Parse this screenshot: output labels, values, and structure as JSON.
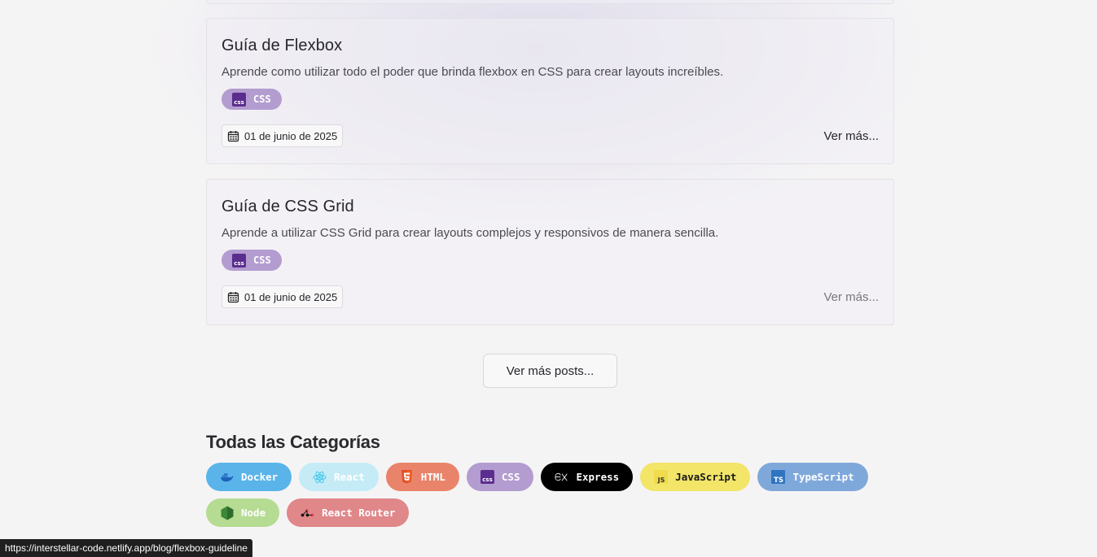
{
  "posts": [
    {
      "title": "Guía de Flexbox",
      "description": "Aprende como utilizar todo el poder que brinda flexbox en CSS para crear layouts increíbles.",
      "tag": "CSS",
      "date": "01 de junio de 2025",
      "see_more": "Ver más..."
    },
    {
      "title": "Guía de CSS Grid",
      "description": "Aprende a utilizar CSS Grid para crear layouts complejos y responsivos de manera sencilla.",
      "tag": "CSS",
      "date": "01 de junio de 2025",
      "see_more": "Ver más..."
    }
  ],
  "more_posts_label": "Ver más posts...",
  "categories": {
    "title": "Todas las Categorías",
    "items": [
      {
        "label": "Docker",
        "icon": "docker-icon",
        "color": "#5ab4ea",
        "text_color": "#ffffff"
      },
      {
        "label": "React",
        "icon": "react-icon",
        "color": "#c5ecf6",
        "text_color": "#ffffff"
      },
      {
        "label": "HTML",
        "icon": "html5-icon",
        "color": "#e9846a",
        "text_color": "#ffffff"
      },
      {
        "label": "CSS",
        "icon": "css-icon",
        "color": "#b39cd0",
        "text_color": "#ffffff"
      },
      {
        "label": "Express",
        "icon": "express-icon",
        "color": "#000000",
        "text_color": "#ffffff"
      },
      {
        "label": "JavaScript",
        "icon": "javascript-icon",
        "color": "#f2e568",
        "text_color": "#1a1a1a"
      },
      {
        "label": "TypeScript",
        "icon": "typescript-icon",
        "color": "#7fa8da",
        "text_color": "#ffffff"
      },
      {
        "label": "Node",
        "icon": "node-icon",
        "color": "#b5dc92",
        "text_color": "#ffffff"
      },
      {
        "label": "React Router",
        "icon": "react-router-icon",
        "color": "#e0878a",
        "text_color": "#ffffff"
      }
    ]
  },
  "status_url": "https://interstellar-code.netlify.app/blog/flexbox-guideline"
}
